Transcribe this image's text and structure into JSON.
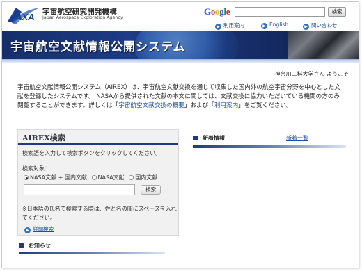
{
  "header": {
    "logo_wordmark": "JAXA",
    "org_name_ja": "宇宙航空研究開発機構",
    "org_name_en": "Japan Aerospace Exploration Agency",
    "google_label": "Google",
    "search_value": "",
    "search_button": "検索",
    "links": [
      {
        "label": "利用案内"
      },
      {
        "label": "English"
      },
      {
        "label": "問い合わせ"
      }
    ]
  },
  "banner": {
    "title": "宇宙航空文献情報公開システム"
  },
  "welcome": "神奈川工科大学さん ようこそ",
  "intro": {
    "text1": "宇宙航空文献情報公開システム（AIREX）は、宇宙航空文献交換を通じて収集した国内外の航空宇宙分野を中心とした文献を登録したシステムです。 NASAから提供された文献の本文に関しては、文献交換に協力いただいている機関の方のみ閲覧することができます。詳しくは「",
    "link1": "宇宙航空文献交換の概要",
    "text2": "」および「",
    "link2": "利用案内",
    "text3": "」をご覧ください。"
  },
  "search_panel": {
    "title": "AIREX検索",
    "instruction": "検索語を入力して検索ボタンをクリックしてください。",
    "target_label": "検索対象：",
    "options": [
      {
        "label": "NASA文献 + 国内文献",
        "selected": true
      },
      {
        "label": "NASA文献",
        "selected": false
      },
      {
        "label": "国内文献",
        "selected": false
      }
    ],
    "query_value": "",
    "search_button": "検索",
    "note": "※日本語の氏名で検索する際は、姓と名の間にスペースを入れてください。",
    "detail_link": "詳細検索"
  },
  "news": {
    "title": "新着情報",
    "more_link": "新着一覧"
  },
  "notices": {
    "title": "お知らせ"
  },
  "colors": {
    "brand_navy": "#1f3a80",
    "link_blue": "#1a4fa8"
  }
}
